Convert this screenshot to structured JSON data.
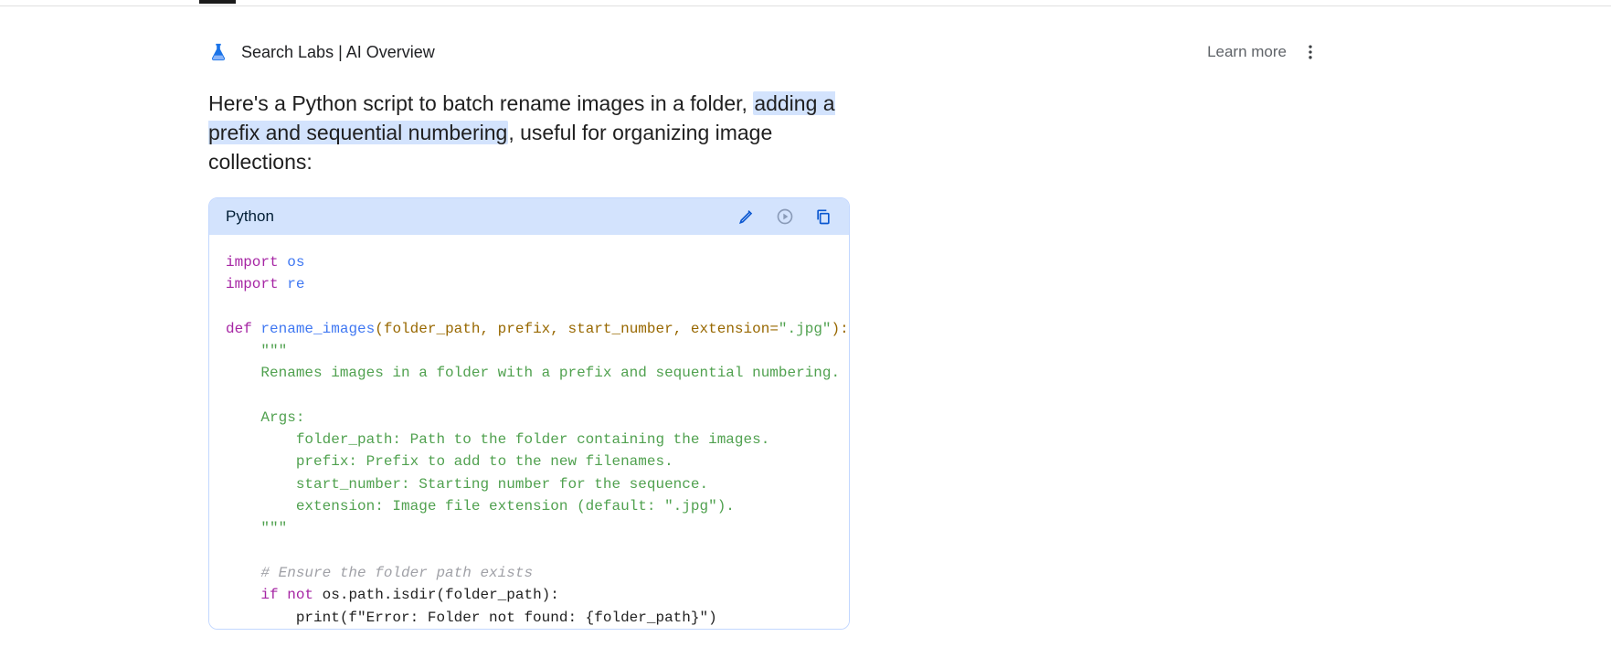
{
  "header": {
    "title": "Search Labs | AI Overview",
    "learn_more": "Learn more"
  },
  "intro": {
    "before_hl": "Here's a Python script to batch rename images in a folder, ",
    "highlighted": "adding a prefix and sequential numbering",
    "after_hl": ", useful for organizing image collections:"
  },
  "code": {
    "language": "Python",
    "l1_kw": "import",
    "l1_mod": "os",
    "l2_kw": "import",
    "l2_mod": "re",
    "l_def": "def",
    "l_fn": "rename_images",
    "l_params": "(folder_path, prefix, start_number, extension=",
    "l_params_str": "\".jpg\"",
    "l_params_end": "):",
    "doc_open": "    \"\"\"",
    "doc1": "    Renames images in a folder with a prefix and sequential numbering.",
    "doc_args": "    Args:",
    "doc_a1": "        folder_path: Path to the folder containing the images.",
    "doc_a2": "        prefix: Prefix to add to the new filenames.",
    "doc_a3": "        start_number: Starting number for the sequence.",
    "doc_a4": "        extension: Image file extension (default: \".jpg\").",
    "doc_close": "    \"\"\"",
    "cmt1": "    # Ensure the folder path exists",
    "if_kw": "if",
    "not_kw": "not",
    "if_rest": " os.path.isdir(folder_path):",
    "print_line": "        print(f\"Error: Folder not found: {folder_path}\")"
  }
}
